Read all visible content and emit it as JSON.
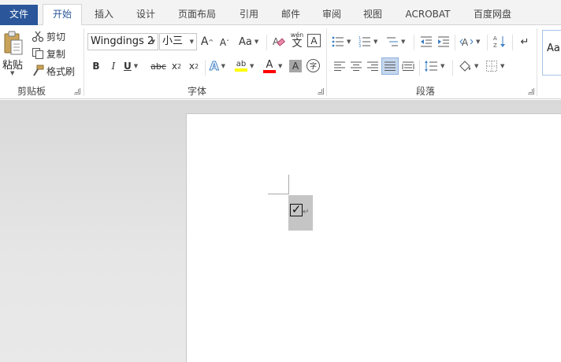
{
  "tabs": [
    {
      "id": "file",
      "label": "文件"
    },
    {
      "id": "home",
      "label": "开始",
      "active": true
    },
    {
      "id": "insert",
      "label": "插入"
    },
    {
      "id": "design",
      "label": "设计"
    },
    {
      "id": "layout",
      "label": "页面布局"
    },
    {
      "id": "references",
      "label": "引用"
    },
    {
      "id": "mailings",
      "label": "邮件"
    },
    {
      "id": "review",
      "label": "审阅"
    },
    {
      "id": "view",
      "label": "视图"
    },
    {
      "id": "acrobat",
      "label": "ACROBAT"
    },
    {
      "id": "baidu",
      "label": "百度网盘"
    }
  ],
  "clipboard": {
    "paste": "粘贴",
    "cut": "剪切",
    "copy": "复制",
    "format_painter": "格式刷",
    "group_label": "剪贴板"
  },
  "font": {
    "font_name": "Wingdings 2",
    "font_size": "小三",
    "grow": "A",
    "shrink": "A",
    "change_case": "Aa",
    "bold": "B",
    "italic": "I",
    "underline": "U",
    "strikethrough": "abc",
    "subscript_base": "x",
    "subscript_mark": "2",
    "superscript_base": "x",
    "superscript_mark": "2",
    "text_effects": "A",
    "highlight": "ab",
    "font_color": "A",
    "char_shading": "A",
    "enclose": "字",
    "phonetic": "wén",
    "phonetic_char": "文",
    "char_border": "A",
    "group_label": "字体"
  },
  "paragraph": {
    "group_label": "段落"
  },
  "styles": {
    "preview": "AaB"
  },
  "document": {
    "content": "☑",
    "paragraph_mark": "↵"
  },
  "colors": {
    "file_tab": "#2b579a",
    "accent": "#2b579a",
    "highlight_bar": "#ffff00",
    "font_color_bar": "#ff0000"
  }
}
